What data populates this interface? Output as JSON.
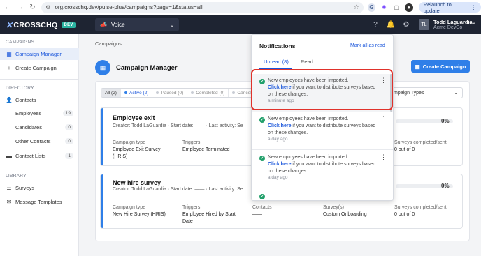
{
  "browser": {
    "url": "org.crosschq.dev/pulse-plus/campaigns?page=1&status=all",
    "relaunch_label": "Relaunch to update",
    "relaunch_menu_icon": "⋮"
  },
  "topnav": {
    "logo_text": "CROSSCHQ",
    "env_badge": "DEV",
    "product": "Voice",
    "user_initials": "TL",
    "user_name": "Todd Laguardia",
    "user_org": "Acme DevCo"
  },
  "sidebar": {
    "campaigns_section": "CAMPAIGNS",
    "campaign_manager": "Campaign Manager",
    "create_campaign": "Create Campaign",
    "directory_section": "DIRECTORY",
    "contacts": "Contacts",
    "employees": "Employees",
    "employees_count": "19",
    "candidates": "Candidates",
    "candidates_count": "0",
    "other_contacts": "Other Contacts",
    "other_contacts_count": "0",
    "contact_lists": "Contact Lists",
    "contact_lists_count": "1",
    "library_section": "LIBRARY",
    "surveys": "Surveys",
    "message_templates": "Message Templates"
  },
  "main": {
    "breadcrumb": "Campaigns",
    "title": "Campaign Manager",
    "create_button": "Create Campaign",
    "filters": [
      "All (2)",
      "Active (2)",
      "Paused (0)",
      "Completed (0)",
      "Cancele"
    ],
    "type_select": "mpaign Types",
    "campaigns": [
      {
        "name": "Employee exit",
        "creator": "Creator: Todd LaGuardia",
        "start": "Start date: ——",
        "last_activity": "Last activity: Se",
        "percent": "0%",
        "type_label": "Campaign type",
        "type_value": "Employee Exit Survey (HRIS)",
        "triggers_label": "Triggers",
        "triggers_value": "Employee Terminated",
        "contacts_label": "Contacts",
        "contacts_value": "——",
        "surveys_label": "Survey(s)",
        "surveys_value": "",
        "completed_label": "Surveys completed/sent",
        "completed_value": "0 out of 0"
      },
      {
        "name": "New hire survey",
        "creator": "Creator: Todd LaGuardia",
        "start": "Start date: ——",
        "last_activity": "Last activity: Se",
        "percent": "0%",
        "type_label": "Campaign type",
        "type_value": "New Hire Survey (HRIS)",
        "triggers_label": "Triggers",
        "triggers_value": "Employee Hired by Start Date",
        "contacts_label": "Contacts",
        "contacts_value": "——",
        "surveys_label": "Survey(s)",
        "surveys_value": "Custom Onboarding",
        "completed_label": "Surveys completed/sent",
        "completed_value": "0 out of 0"
      }
    ]
  },
  "notifications": {
    "title": "Notifications",
    "mark_all": "Mark all as read",
    "tab_unread": "Unread (8)",
    "tab_read": "Read",
    "items": [
      {
        "line1": "New employees have been imported.",
        "link": "Click here",
        "rest": " if you want to distribute surveys based on these changes.",
        "time": "a minute ago"
      },
      {
        "line1": "New employees have been imported.",
        "link": "Click here",
        "rest": " if you want to distribute surveys based on these changes.",
        "time": "a day ago"
      },
      {
        "line1": "New employees have been imported.",
        "link": "Click here",
        "rest": " if you want to distribute surveys based on these changes.",
        "time": "a day ago"
      }
    ]
  },
  "colors": {
    "accent": "#2f7fe8",
    "nav_bg": "#1e2432",
    "highlight_box": "#e0322b",
    "success": "#22a06b"
  }
}
